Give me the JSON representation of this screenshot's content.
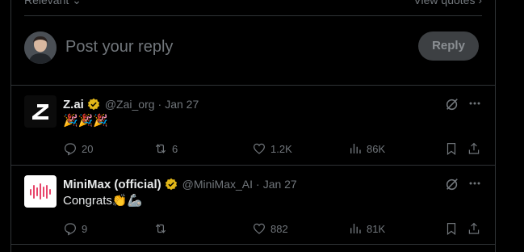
{
  "top_bar": {
    "sort_label": "Relevant",
    "quotes_label": "View quotes"
  },
  "composer": {
    "placeholder": "Post your reply",
    "reply_label": "Reply"
  },
  "tweets": [
    {
      "name": "Z.ai",
      "handle": "@Zai_org",
      "separator": "·",
      "date": "Jan 27",
      "text": "🎉🎉🎉",
      "replies": "20",
      "reposts": "6",
      "likes": "1.2K",
      "views": "86K",
      "avatar_letter": "Z"
    },
    {
      "name": "MiniMax (official)",
      "handle": "@MiniMax_AI",
      "separator": "·",
      "date": "Jan 27",
      "text": "Congrats👏🦾",
      "replies": "9",
      "reposts": "",
      "likes": "882",
      "views": "81K",
      "avatar_letter": ""
    }
  ],
  "colors": {
    "background": "#000000",
    "border": "#2f3336",
    "muted": "#71767b",
    "text": "#e7e9ea",
    "verified": "#e2b719",
    "minimax_pink": "#e8456b"
  }
}
